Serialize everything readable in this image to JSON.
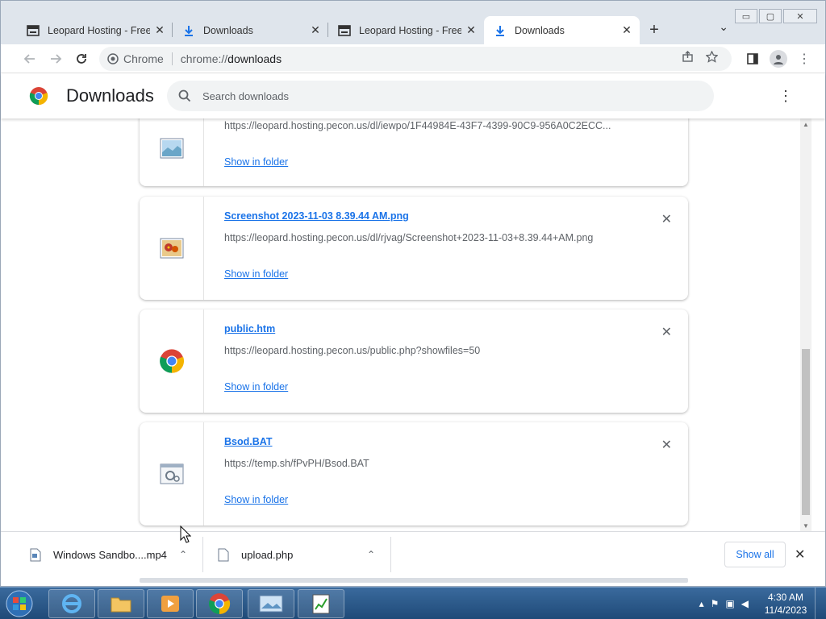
{
  "window": {
    "controls": {
      "minimize": "▭",
      "maximize": "▢",
      "close": "✕"
    }
  },
  "tabs": [
    {
      "title": "Leopard Hosting - Free I",
      "icon": "film-icon",
      "active": false
    },
    {
      "title": "Downloads",
      "icon": "download-icon",
      "active": false
    },
    {
      "title": "Leopard Hosting - Free I",
      "icon": "film-icon",
      "active": false
    },
    {
      "title": "Downloads",
      "icon": "download-icon",
      "active": true
    }
  ],
  "toolbar": {
    "new_tab": "+",
    "tab_menu": "⌄",
    "site_name": "Chrome",
    "url_scheme": "chrome://",
    "url_path": "downloads"
  },
  "downloads_page": {
    "title": "Downloads",
    "search_placeholder": "Search downloads",
    "more": "⋮"
  },
  "items": [
    {
      "name": "",
      "url": "https://leopard.hosting.pecon.us/dl/iewpo/1F44984E-43F7-4399-90C9-956A0C2ECC...",
      "action": "Show in folder",
      "icon": "image-file-icon"
    },
    {
      "name": "Screenshot 2023-11-03 8.39.44 AM.png",
      "url": "https://leopard.hosting.pecon.us/dl/rjvag/Screenshot+2023-11-03+8.39.44+AM.png",
      "action": "Show in folder",
      "icon": "flower-image-icon"
    },
    {
      "name": "public.htm",
      "url": "https://leopard.hosting.pecon.us/public.php?showfiles=50",
      "action": "Show in folder",
      "icon": "chrome-icon"
    },
    {
      "name": "Bsod.BAT",
      "url": "https://temp.sh/fPvPH/Bsod.BAT",
      "action": "Show in folder",
      "icon": "batch-file-icon"
    }
  ],
  "shelf": {
    "items": [
      {
        "name": "Windows Sandbo....mp4",
        "icon": "video-file-icon"
      },
      {
        "name": "upload.php",
        "icon": "file-icon"
      }
    ],
    "show_all": "Show all",
    "close": "✕"
  },
  "taskbar": {
    "time": "4:30 AM",
    "date": "11/4/2023"
  }
}
